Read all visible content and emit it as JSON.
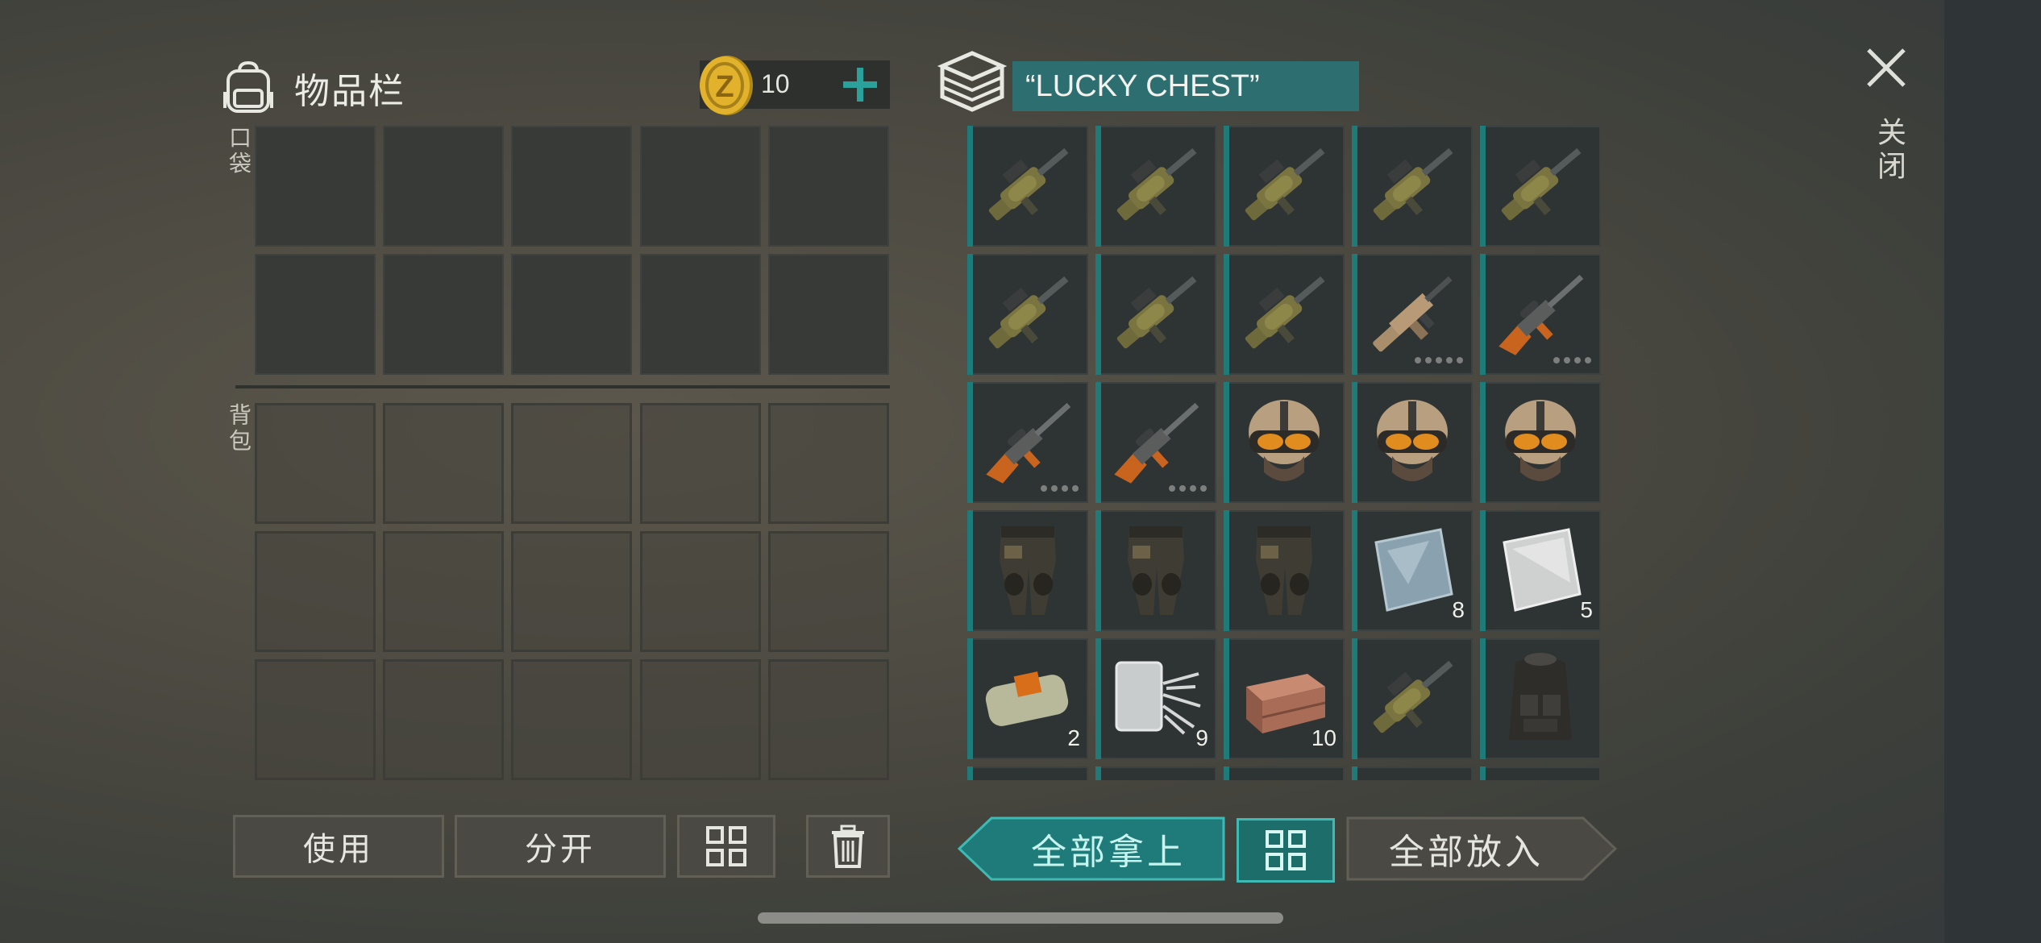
{
  "inventory": {
    "title": "物品栏",
    "coins": "10",
    "pocket_label": "口袋",
    "backpack_label": "背包",
    "buttons": {
      "use": "使用",
      "split": "分开"
    }
  },
  "chest": {
    "title": "“LUCKY CHEST”",
    "take_all": "全部拿上",
    "put_all": "全部放入",
    "items": [
      {
        "icon": "grenade-launcher-icon"
      },
      {
        "icon": "grenade-launcher-icon"
      },
      {
        "icon": "grenade-launcher-icon"
      },
      {
        "icon": "grenade-launcher-icon"
      },
      {
        "icon": "grenade-launcher-icon"
      },
      {
        "icon": "grenade-launcher-icon"
      },
      {
        "icon": "grenade-launcher-icon"
      },
      {
        "icon": "grenade-launcher-icon"
      },
      {
        "icon": "assault-rifle-icon",
        "durability": 5
      },
      {
        "icon": "sniper-rifle-icon",
        "durability": 4
      },
      {
        "icon": "sniper-rifle-icon",
        "durability": 4
      },
      {
        "icon": "sniper-rifle-icon",
        "durability": 4
      },
      {
        "icon": "tactical-helmet-icon"
      },
      {
        "icon": "tactical-helmet-icon"
      },
      {
        "icon": "tactical-helmet-icon"
      },
      {
        "icon": "armored-pants-icon"
      },
      {
        "icon": "armored-pants-icon"
      },
      {
        "icon": "armored-pants-icon"
      },
      {
        "icon": "glass-sheet-icon",
        "qty": "8"
      },
      {
        "icon": "metal-sheet-icon",
        "qty": "5"
      },
      {
        "icon": "explosive-block-icon",
        "qty": "2"
      },
      {
        "icon": "fiberglass-icon",
        "qty": "9"
      },
      {
        "icon": "bricks-icon",
        "qty": "10"
      },
      {
        "icon": "grenade-launcher-icon"
      },
      {
        "icon": "tactical-vest-icon"
      },
      {
        "icon": "sniper-rifle-icon"
      },
      {
        "icon": "armored-pants-icon"
      },
      {
        "icon": "tactical-helmet-icon"
      },
      {
        "icon": "sniper-rifle-icon"
      },
      {
        "icon": "armored-pants-icon"
      }
    ]
  },
  "close_label": "关闭",
  "colors": {
    "accent": "#1f7b79",
    "accent_light": "#3fb9b3",
    "coin": "#e2b22c"
  }
}
